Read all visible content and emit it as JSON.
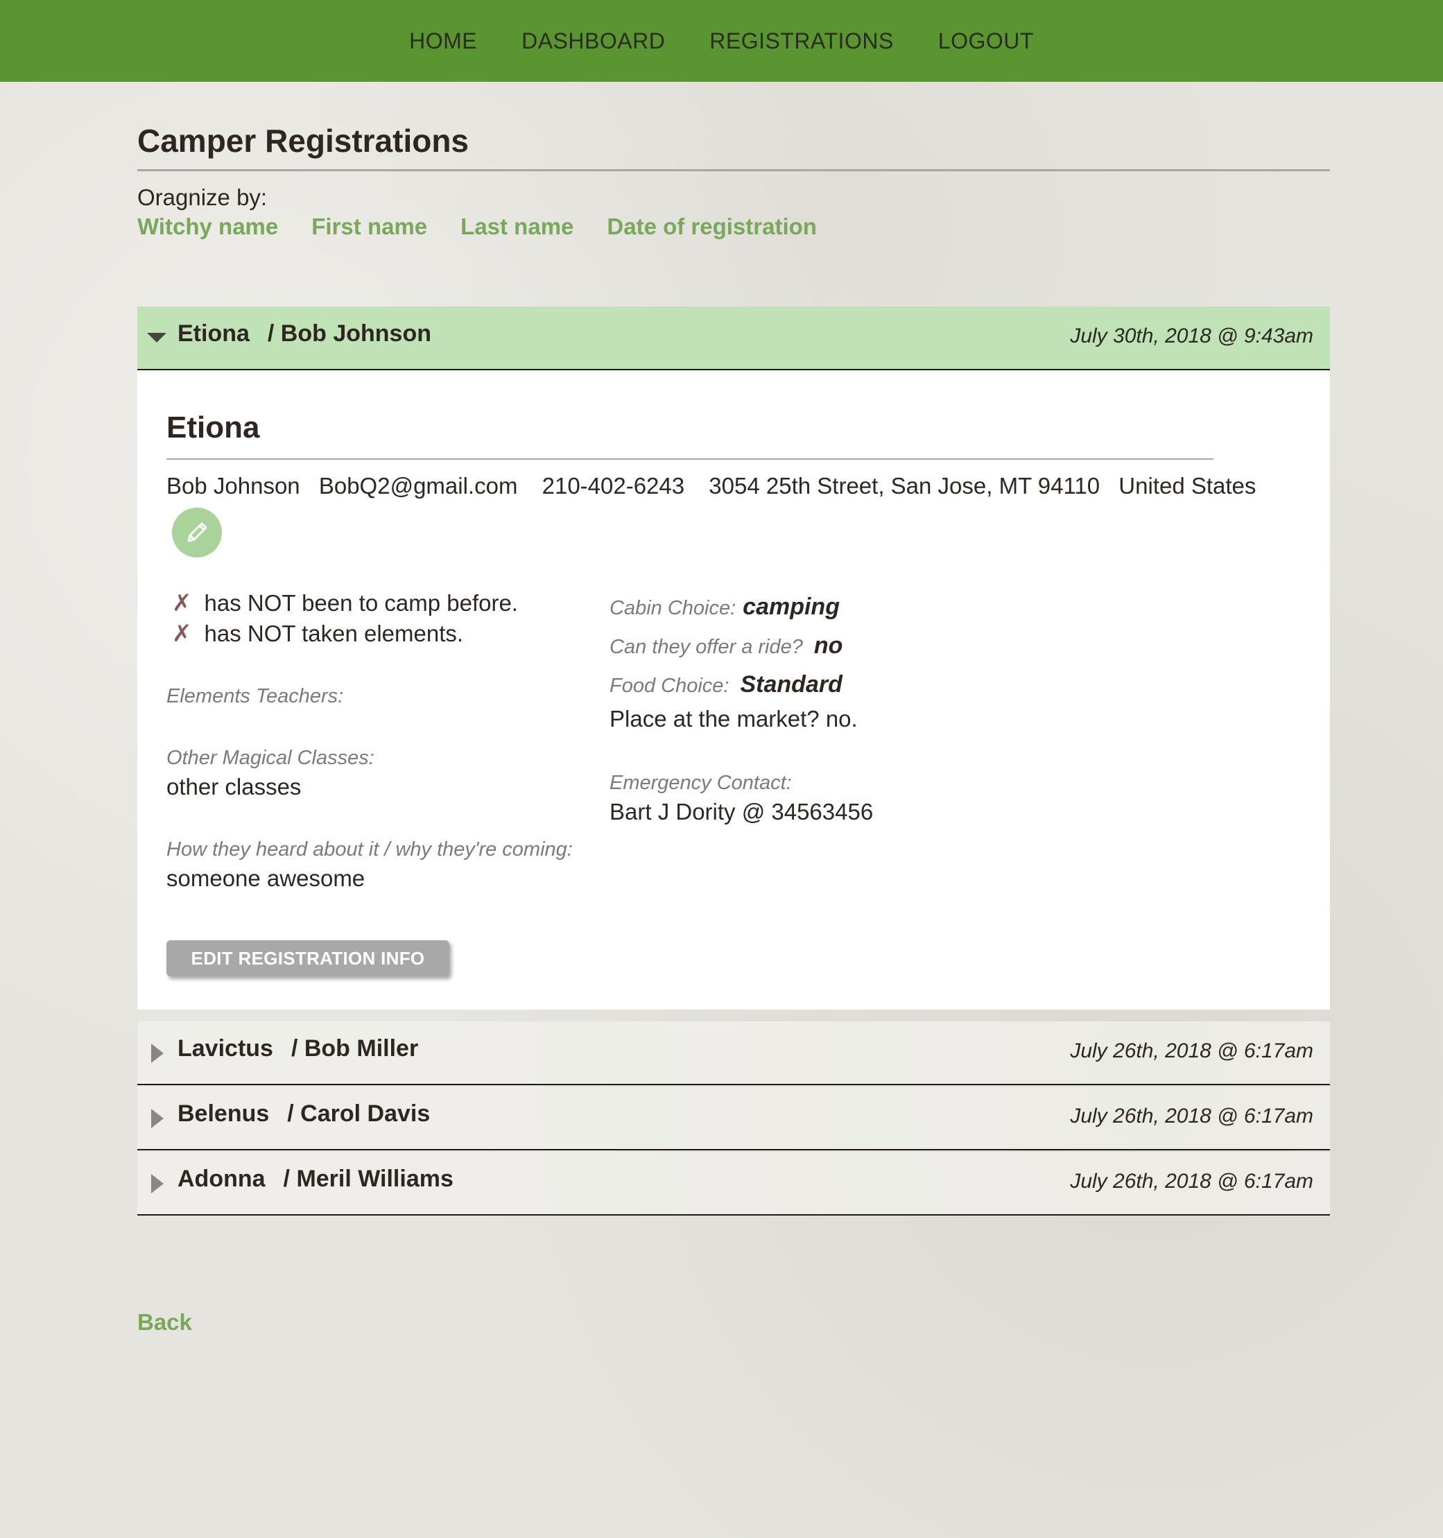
{
  "nav": {
    "items": [
      "HOME",
      "DASHBOARD",
      "REGISTRATIONS",
      "LOGOUT"
    ]
  },
  "page": {
    "title": "Camper Registrations",
    "organize_label": "Oragnize by:",
    "sort_links": [
      "Witchy name",
      "First name",
      "Last name",
      "Date of registration"
    ],
    "back_label": "Back"
  },
  "registrations": [
    {
      "witchy_name": "Etiona",
      "full_name": "/ Bob Johnson",
      "date": "July 30th, 2018 @ 9:43am",
      "expanded": true
    },
    {
      "witchy_name": "Lavictus",
      "full_name": "/ Bob Miller",
      "date": "July 26th, 2018 @ 6:17am",
      "expanded": false
    },
    {
      "witchy_name": "Belenus",
      "full_name": "/ Carol Davis",
      "date": "July 26th, 2018 @ 6:17am",
      "expanded": false
    },
    {
      "witchy_name": "Adonna",
      "full_name": "/ Meril Williams",
      "date": "July 26th, 2018 @ 6:17am",
      "expanded": false
    }
  ],
  "detail": {
    "title": "Etiona",
    "contact": {
      "name": "Bob Johnson",
      "email": "BobQ2@gmail.com",
      "phone": "210-402-6243",
      "address": "3054 25th Street, San Jose, MT 94110",
      "country": "United States"
    },
    "checks": [
      "has NOT been to camp before.",
      "has NOT taken elements."
    ],
    "check_mark": "✗",
    "elements_teachers_label": "Elements Teachers:",
    "other_classes_label": "Other Magical Classes:",
    "other_classes_value": "other classes",
    "heard_label": "How they heard about it / why they're coming:",
    "heard_value": "someone awesome",
    "cabin_label": "Cabin Choice:",
    "cabin_value": "camping",
    "ride_label": "Can they offer a ride?",
    "ride_value": "no",
    "food_label": "Food Choice:",
    "food_value": "Standard",
    "market_text": "Place at the market? no.",
    "emergency_label": "Emergency Contact:",
    "emergency_value": "Bart J Dority @ 34563456",
    "edit_button_label": "EDIT REGISTRATION INFO",
    "edit_icon": "pencil-icon"
  },
  "colors": {
    "navbar": "#5a9532",
    "link_green": "#79a85c",
    "open_header": "#bfe3b6",
    "edit_circle": "#a9d39a",
    "button_gray": "#a8a8a8"
  }
}
